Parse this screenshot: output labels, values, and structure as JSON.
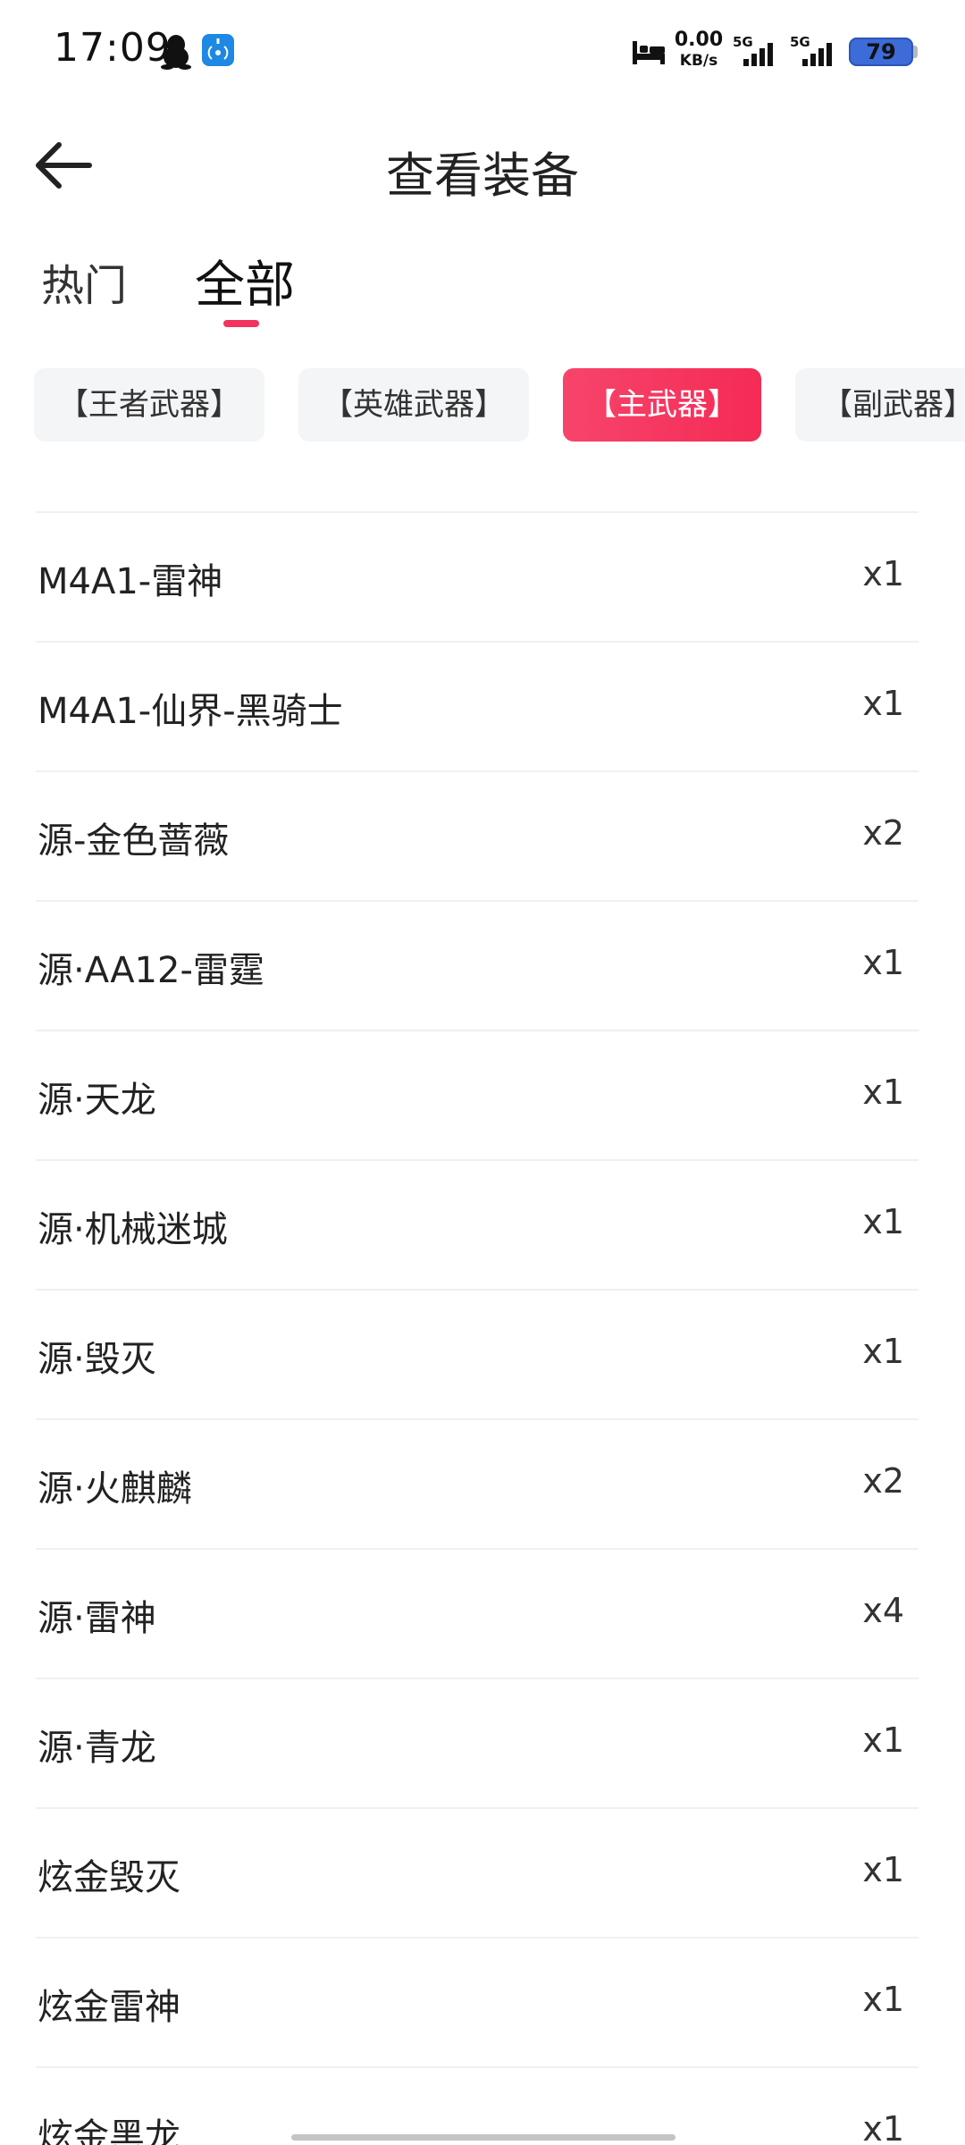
{
  "status_bar": {
    "time": "17:09",
    "net_speed_value": "0.00",
    "net_speed_unit": "KB/s",
    "sim1_label": "5G",
    "sim2_label": "5G",
    "battery_level": "79",
    "icons": [
      "penguin-icon",
      "broadcast-icon",
      "bed-icon",
      "signal-icon",
      "battery-icon"
    ]
  },
  "header": {
    "title": "查看装备",
    "back_icon": "arrow-left-icon"
  },
  "tabs": [
    {
      "label": "热门",
      "active": false
    },
    {
      "label": "全部",
      "active": true
    }
  ],
  "categories": [
    {
      "label": "【王者武器】",
      "selected": false
    },
    {
      "label": "【英雄武器】",
      "selected": false
    },
    {
      "label": "【主武器】",
      "selected": true
    },
    {
      "label": "【副武器】",
      "selected": false
    }
  ],
  "items": [
    {
      "name": "M4A1-雷神",
      "count": "x1"
    },
    {
      "name": "M4A1-仙界-黑骑士",
      "count": "x1"
    },
    {
      "name": "源-金色蔷薇",
      "count": "x2"
    },
    {
      "name": "源·AA12-雷霆",
      "count": "x1"
    },
    {
      "name": "源·天龙",
      "count": "x1"
    },
    {
      "name": "源·机械迷城",
      "count": "x1"
    },
    {
      "name": "源·毁灭",
      "count": "x1"
    },
    {
      "name": "源·火麒麟",
      "count": "x2"
    },
    {
      "name": "源·雷神",
      "count": "x4"
    },
    {
      "name": "源·青龙",
      "count": "x1"
    },
    {
      "name": "炫金毁灭",
      "count": "x1"
    },
    {
      "name": "炫金雷神",
      "count": "x1"
    },
    {
      "name": "炫金黑龙",
      "count": "x1"
    }
  ],
  "colors": {
    "accent": "#f42b55",
    "chip_bg": "#f3f5f7",
    "divider": "#f0f0f0",
    "battery": "#3d6bd8"
  }
}
